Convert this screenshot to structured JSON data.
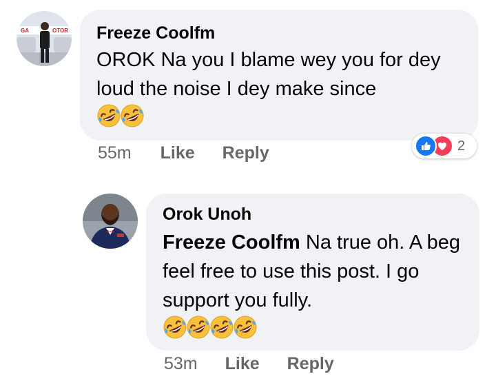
{
  "comment1": {
    "author": "Freeze Coolfm",
    "text": "OROK Na you I blame wey you for dey loud the noise I dey make since",
    "emojis": [
      "rolling-on-floor-laughing-emoji",
      "rolling-on-floor-laughing-emoji"
    ],
    "time": "55m",
    "like_label": "Like",
    "reply_label": "Reply",
    "reactions": [
      "like-icon",
      "love-icon"
    ],
    "reaction_count": "2",
    "avatar_sign": "GA OTOR"
  },
  "comment2": {
    "author": "Orok Unoh",
    "mention": "Freeze Coolfm",
    "text": " Na true oh. A beg feel free to use this post. I go support you fully.",
    "emojis": [
      "rolling-on-floor-laughing-emoji",
      "rolling-on-floor-laughing-emoji",
      "rolling-on-floor-laughing-emoji",
      "rolling-on-floor-laughing-emoji"
    ],
    "time": "53m",
    "like_label": "Like",
    "reply_label": "Reply"
  },
  "colors": {
    "bubble": "#f0f2f5",
    "meta": "#65676b",
    "like_blue": "#1877f2",
    "love_red": "#f33e58"
  }
}
